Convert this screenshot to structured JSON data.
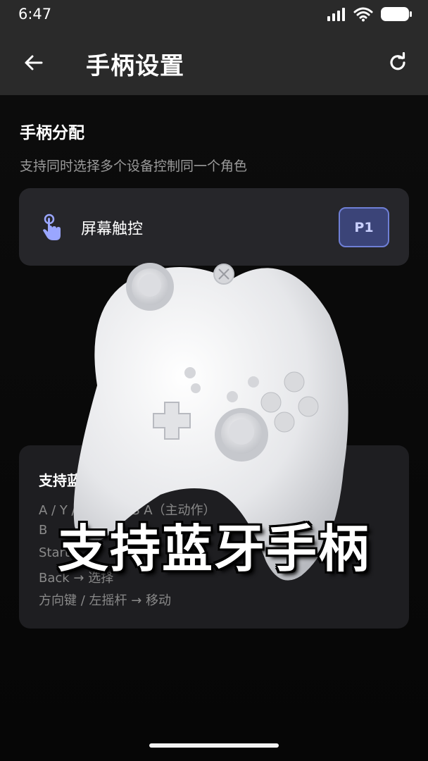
{
  "status_bar": {
    "time": "6:47"
  },
  "app_bar": {
    "title": "手柄设置"
  },
  "assignment": {
    "title": "手柄分配",
    "subtitle": "支持同时选择多个设备控制同一个角色",
    "devices": [
      {
        "label": "屏幕触控",
        "player": "P1"
      }
    ]
  },
  "info_card": {
    "title": "支持蓝牙手柄",
    "mappings": [
      "A / Y / LB → NES A（主动作）",
      "B",
      "Start",
      "Back → 选择",
      "方向键 / 左摇杆 → 移动"
    ]
  },
  "overlay": {
    "caption": "支持蓝牙手柄"
  },
  "colors": {
    "accent": "#6f7fd6",
    "card": "#26262a",
    "header": "#2a2a2a"
  }
}
